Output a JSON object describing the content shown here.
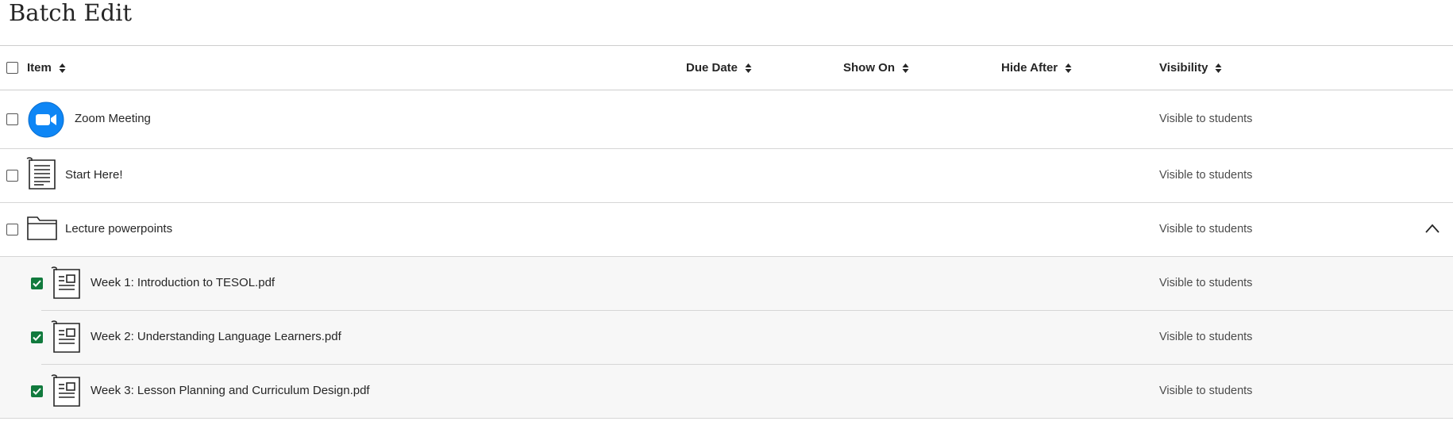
{
  "page": {
    "title": "Batch Edit"
  },
  "columns": [
    {
      "label": "Item"
    },
    {
      "label": "Due Date"
    },
    {
      "label": "Show On"
    },
    {
      "label": "Hide After"
    },
    {
      "label": "Visibility"
    }
  ],
  "rows": [
    {
      "name": "Zoom Meeting",
      "icon": "zoom-icon",
      "visibility": "Visible to students",
      "checked": false
    },
    {
      "name": "Start Here!",
      "icon": "document-icon",
      "visibility": "Visible to students",
      "checked": false
    },
    {
      "name": "Lecture powerpoints",
      "icon": "folder-icon",
      "visibility": "Visible to students",
      "checked": false,
      "expanded": true
    },
    {
      "name": "Week 1: Introduction to TESOL.pdf",
      "icon": "file-icon",
      "visibility": "Visible to students",
      "checked": true
    },
    {
      "name": "Week 2: Understanding Language Learners.pdf",
      "icon": "file-icon",
      "visibility": "Visible to students",
      "checked": true
    },
    {
      "name": "Week 3: Lesson Planning and Curriculum Design.pdf",
      "icon": "file-icon",
      "visibility": "Visible to students",
      "checked": true
    }
  ],
  "colors": {
    "checked": "#117a3d",
    "zoom": "#0e86f5",
    "border": "#cdcdcd"
  }
}
